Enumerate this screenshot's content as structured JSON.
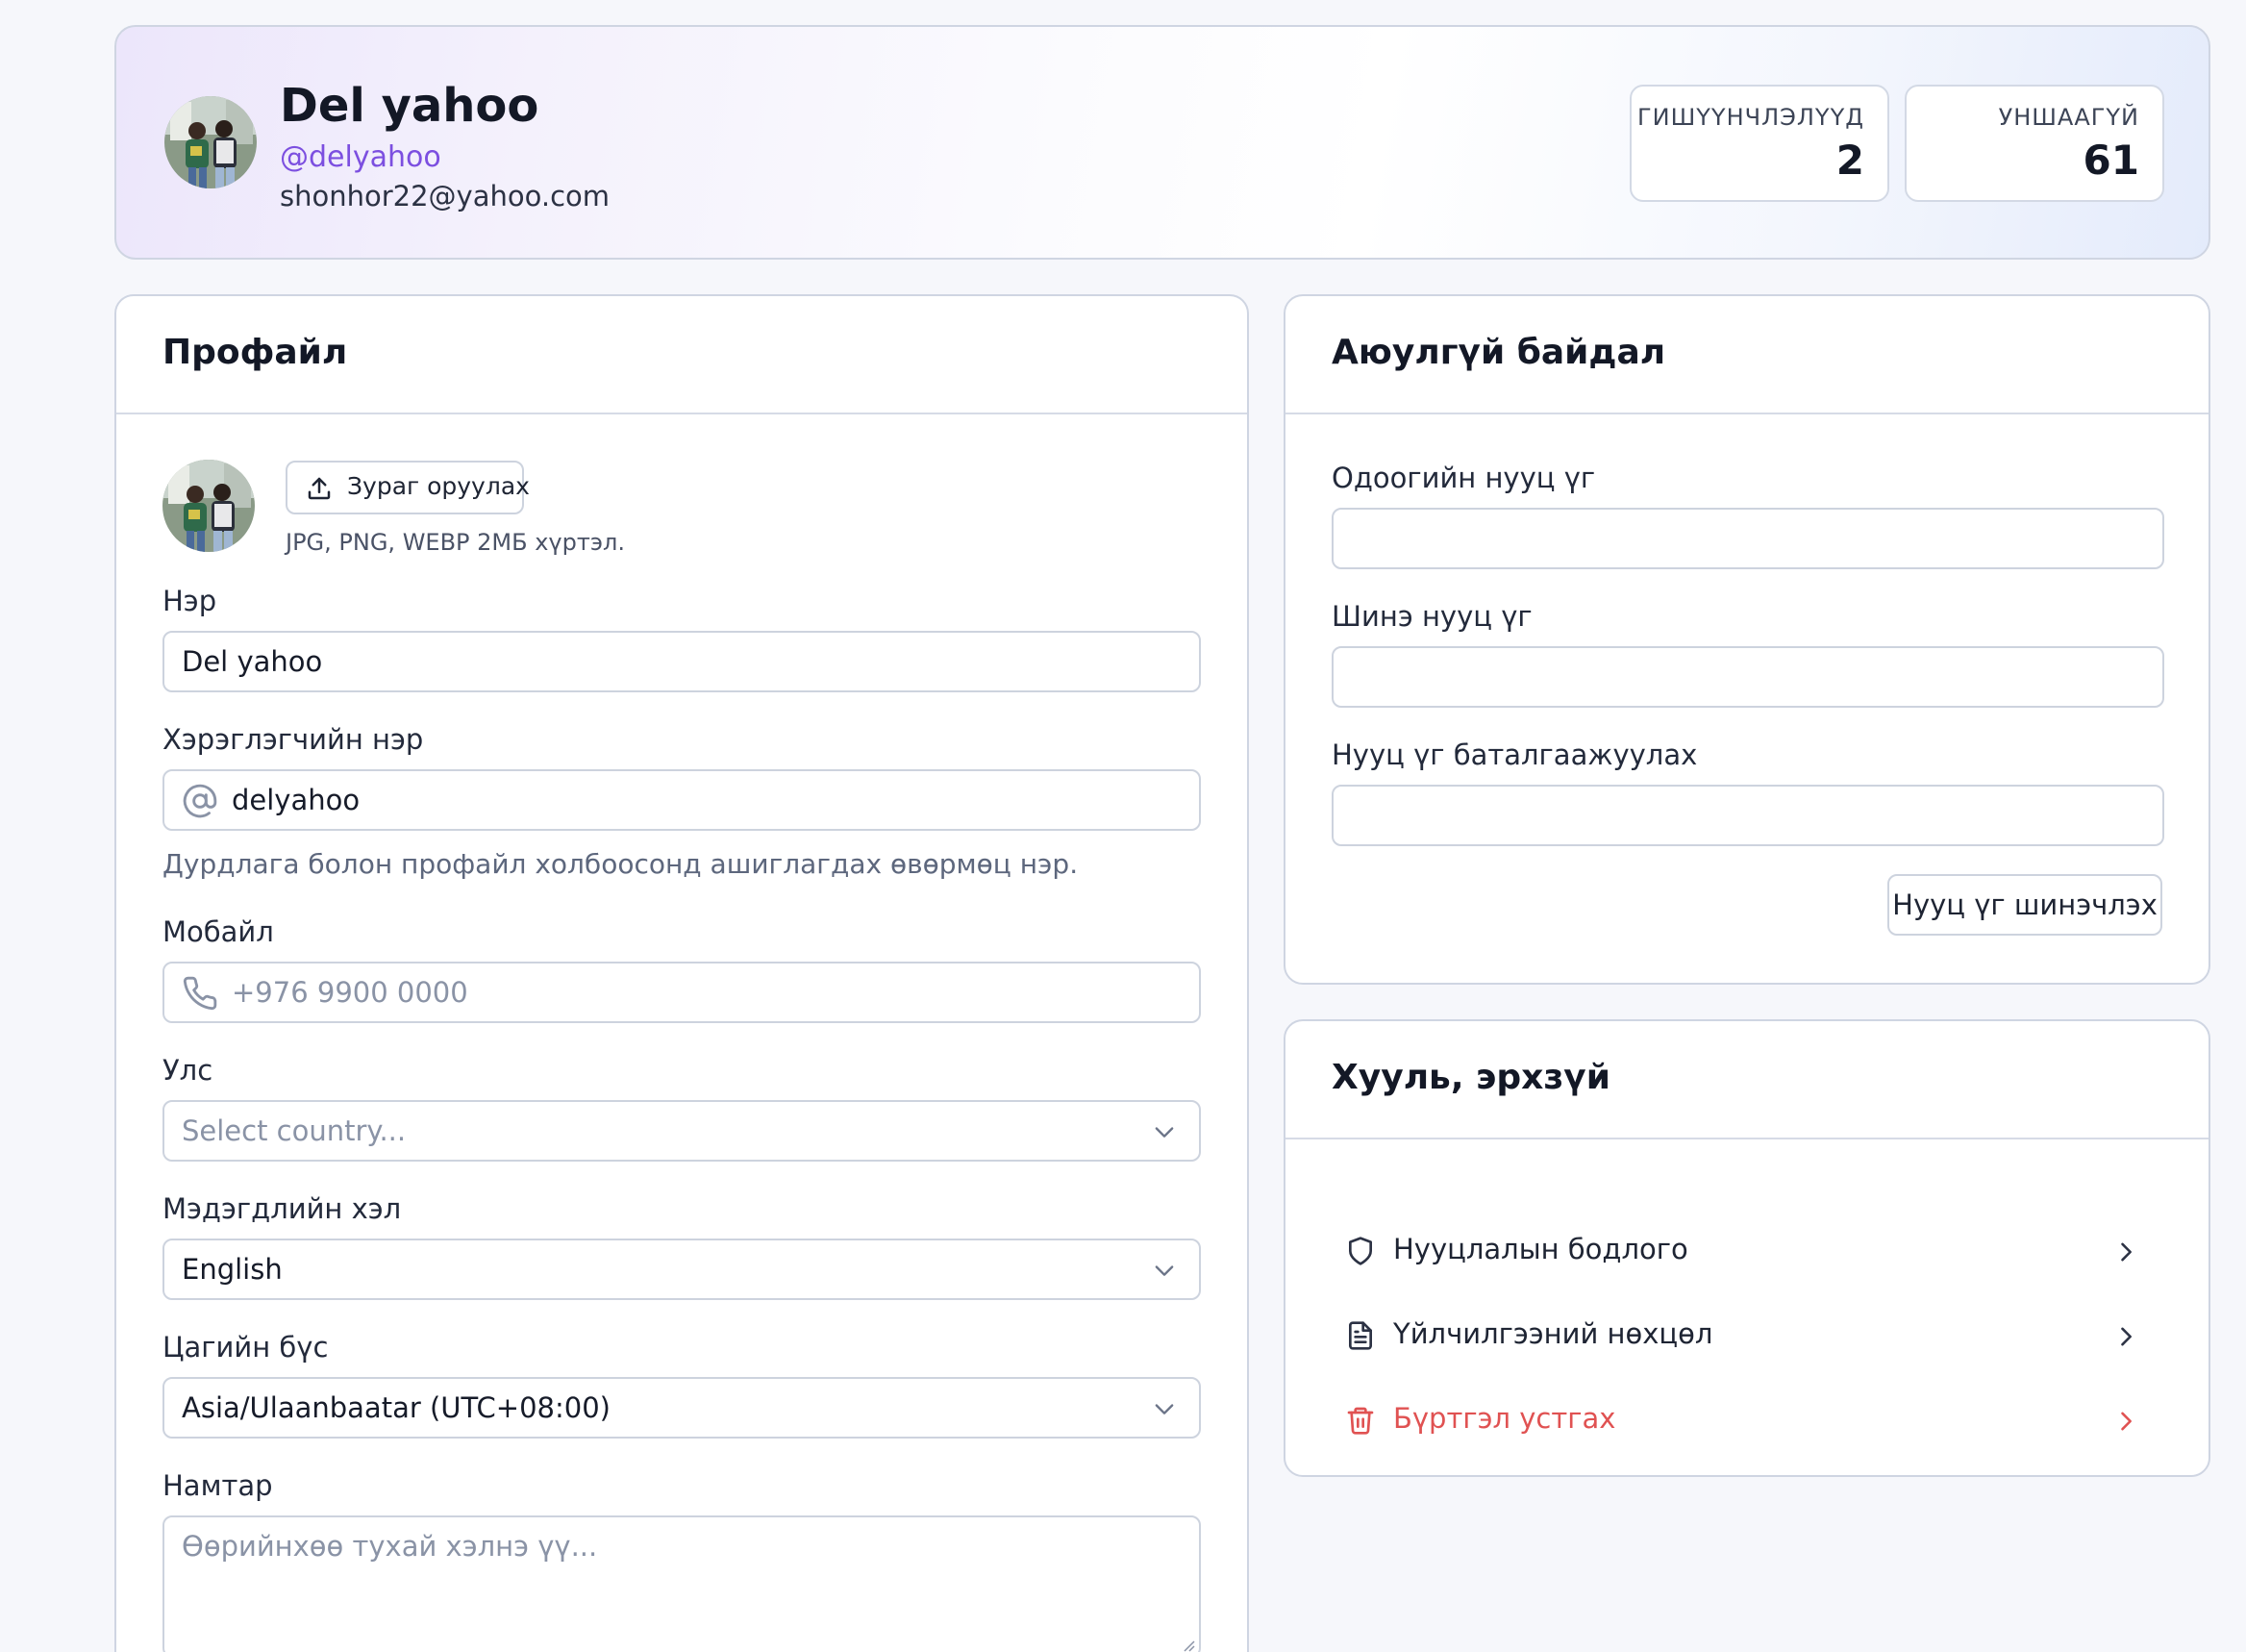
{
  "profile_header": {
    "name": "Del yahoo",
    "handle": "@delyahoo",
    "email": "shonhor22@yahoo.com",
    "stats": [
      {
        "label": "ГИШҮҮНЧЛЭЛҮҮД",
        "value": "2"
      },
      {
        "label": "УНШААГҮЙ",
        "value": "61"
      }
    ]
  },
  "profile_card": {
    "title": "Профайл",
    "upload_button": "Зураг оруулах",
    "upload_hint": "JPG, PNG, WEBP 2МБ хүртэл.",
    "name_label": "Нэр",
    "name_value": "Del yahoo",
    "username_label": "Хэрэглэгчийн нэр",
    "username_value": "delyahoo",
    "username_hint": "Дурдлага болон профайл холбоосонд ашиглагдах өвөрмөц нэр.",
    "mobile_label": "Мобайл",
    "mobile_placeholder": "+976 9900 0000",
    "country_label": "Улс",
    "country_placeholder": "Select country...",
    "language_label": "Мэдэгдлийн хэл",
    "language_value": "English",
    "timezone_label": "Цагийн бүс",
    "timezone_value": "Asia/Ulaanbaatar (UTC+08:00)",
    "bio_label": "Намтар",
    "bio_placeholder": "Өөрийнхөө тухай хэлнэ үү..."
  },
  "security_card": {
    "title": "Аюулгүй байдал",
    "current_password_label": "Одоогийн нууц үг",
    "new_password_label": "Шинэ нууц үг",
    "confirm_password_label": "Нууц үг баталгаажуулах",
    "update_button": "Нууц үг шинэчлэх"
  },
  "legal_card": {
    "title": "Хууль, эрхзүй",
    "items": [
      {
        "label": "Нууцлалын бодлого",
        "icon": "shield-icon"
      },
      {
        "label": "Үйлчилгээний нөхцөл",
        "icon": "document-icon"
      },
      {
        "label": "Бүртгэл устгах",
        "icon": "trash-icon"
      }
    ]
  },
  "colors": {
    "accent": "#7c4fe0",
    "danger": "#e05252",
    "border": "#cfd5e2",
    "background": "#f6f7fb"
  }
}
